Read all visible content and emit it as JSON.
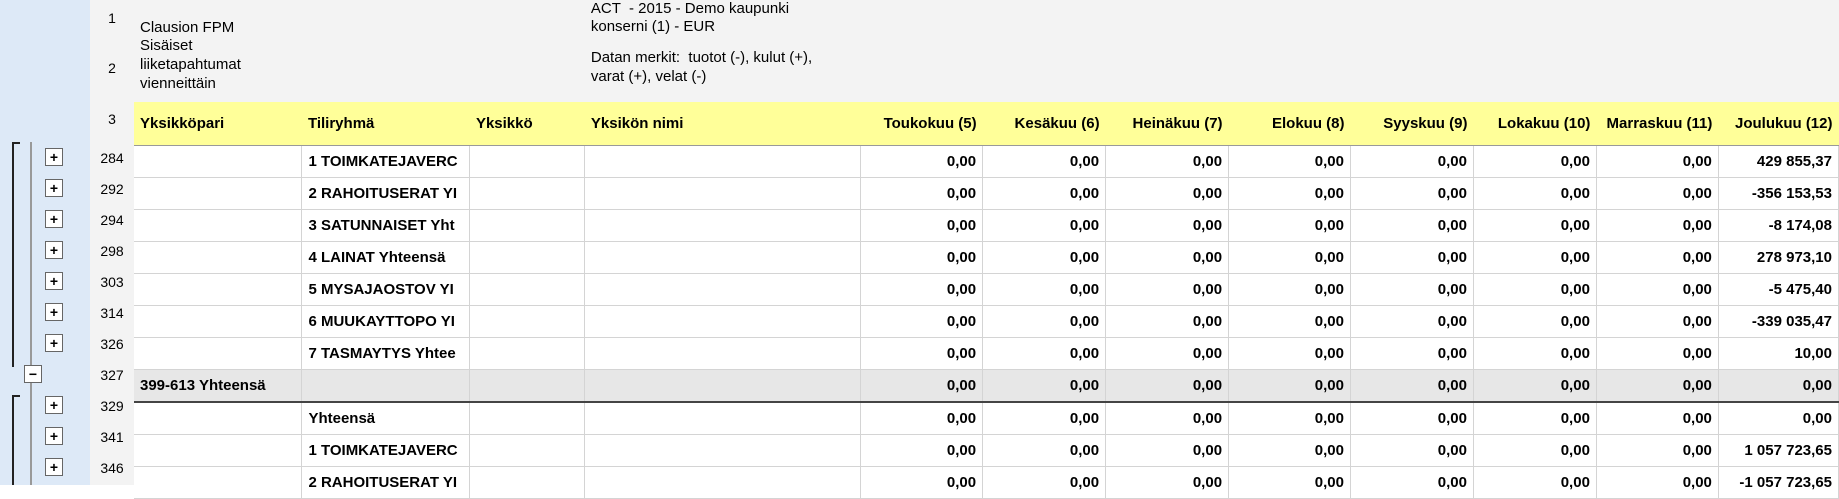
{
  "header": {
    "row1": {
      "num": "1",
      "a": "Clausion FPM",
      "c": "ACT  - 2015 - Demo kaupunki\nkonserni (1) - EUR"
    },
    "row2": {
      "num": "2",
      "a": "Sisäiset\nliiketapahtumat\nvienneittäin",
      "c": "Datan merkit:  tuotot (-), kulut (+),\nvarat (+), velat (-)"
    },
    "row3num": "3"
  },
  "columns": [
    "Yksikköpari",
    "Tiliryhmä",
    "Yksikkö",
    "Yksikön nimi",
    "Toukokuu (5)",
    "Kesäkuu (6)",
    "Heinäkuu (7)",
    "Elokuu (8)",
    "Syyskuu (9)",
    "Lokakuu (10)",
    "Marraskuu (11)",
    "Joulukuu (12)"
  ],
  "rows": [
    {
      "num": "284",
      "pair": "",
      "group": "1  TOIMKATEJAVERC",
      "m5": "0,00",
      "m6": "0,00",
      "m7": "0,00",
      "m8": "0,00",
      "m9": "0,00",
      "m10": "0,00",
      "m11": "0,00",
      "m12": "429 855,37"
    },
    {
      "num": "292",
      "pair": "",
      "group": "2  RAHOITUSERAT YI",
      "m5": "0,00",
      "m6": "0,00",
      "m7": "0,00",
      "m8": "0,00",
      "m9": "0,00",
      "m10": "0,00",
      "m11": "0,00",
      "m12": "-356 153,53"
    },
    {
      "num": "294",
      "pair": "",
      "group": "3  SATUNNAISET Yht",
      "m5": "0,00",
      "m6": "0,00",
      "m7": "0,00",
      "m8": "0,00",
      "m9": "0,00",
      "m10": "0,00",
      "m11": "0,00",
      "m12": "-8 174,08"
    },
    {
      "num": "298",
      "pair": "",
      "group": "4  LAINAT Yhteensä",
      "m5": "0,00",
      "m6": "0,00",
      "m7": "0,00",
      "m8": "0,00",
      "m9": "0,00",
      "m10": "0,00",
      "m11": "0,00",
      "m12": "278 973,10"
    },
    {
      "num": "303",
      "pair": "",
      "group": "5  MYSAJAOSTOV YI",
      "m5": "0,00",
      "m6": "0,00",
      "m7": "0,00",
      "m8": "0,00",
      "m9": "0,00",
      "m10": "0,00",
      "m11": "0,00",
      "m12": "-5 475,40"
    },
    {
      "num": "314",
      "pair": "",
      "group": "6  MUUKAYTTOPO YI",
      "m5": "0,00",
      "m6": "0,00",
      "m7": "0,00",
      "m8": "0,00",
      "m9": "0,00",
      "m10": "0,00",
      "m11": "0,00",
      "m12": "-339 035,47"
    },
    {
      "num": "326",
      "pair": "",
      "group": "7  TASMAYTYS Yhtee",
      "m5": "0,00",
      "m6": "0,00",
      "m7": "0,00",
      "m8": "0,00",
      "m9": "0,00",
      "m10": "0,00",
      "m11": "0,00",
      "m12": "10,00"
    },
    {
      "num": "327",
      "pair": "399-613 Yhteensä",
      "group": "",
      "m5": "0,00",
      "m6": "0,00",
      "m7": "0,00",
      "m8": "0,00",
      "m9": "0,00",
      "m10": "0,00",
      "m11": "0,00",
      "m12": "0,00",
      "total": true
    },
    {
      "num": "329",
      "pair": "",
      "group": " Yhteensä",
      "m5": "0,00",
      "m6": "0,00",
      "m7": "0,00",
      "m8": "0,00",
      "m9": "0,00",
      "m10": "0,00",
      "m11": "0,00",
      "m12": "0,00"
    },
    {
      "num": "341",
      "pair": "",
      "group": "1  TOIMKATEJAVERC",
      "m5": "0,00",
      "m6": "0,00",
      "m7": "0,00",
      "m8": "0,00",
      "m9": "0,00",
      "m10": "0,00",
      "m11": "0,00",
      "m12": "1 057 723,65"
    },
    {
      "num": "346",
      "pair": "",
      "group": "2  RAHOITUSERAT YI",
      "m5": "0,00",
      "m6": "0,00",
      "m7": "0,00",
      "m8": "0,00",
      "m9": "0,00",
      "m10": "0,00",
      "m11": "0,00",
      "m12": "-1 057 723,65"
    }
  ],
  "outline_buttons": {
    "expand": "+",
    "collapse": "−"
  }
}
